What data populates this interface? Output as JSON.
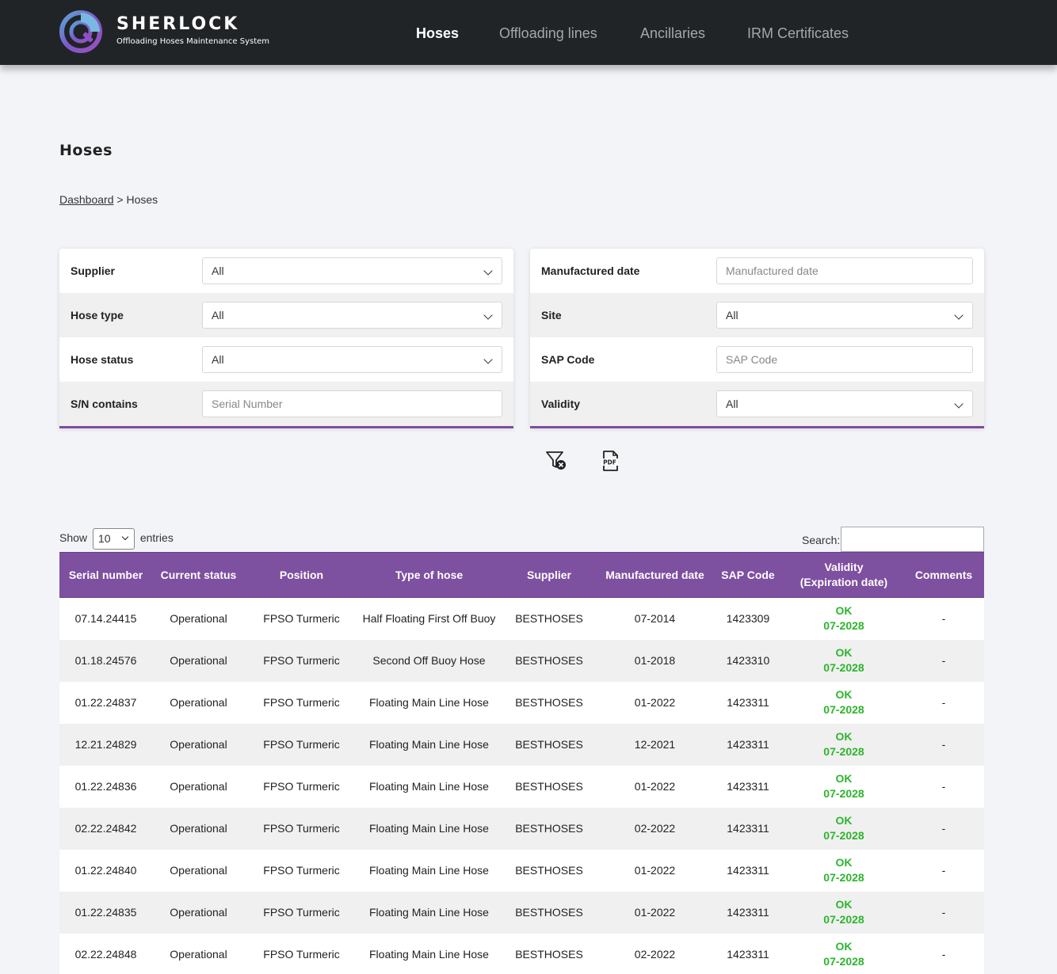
{
  "brand": {
    "name": "SHERLOCK",
    "subtitle": "Offloading Hoses Maintenance System"
  },
  "nav": [
    {
      "label": "Hoses",
      "active": true
    },
    {
      "label": "Offloading lines",
      "active": false
    },
    {
      "label": "Ancillaries",
      "active": false
    },
    {
      "label": "IRM Certificates",
      "active": false
    }
  ],
  "page": {
    "title": "Hoses"
  },
  "breadcrumb": {
    "root": "Dashboard",
    "separator": ">",
    "current": "Hoses"
  },
  "filters": {
    "supplier": {
      "label": "Supplier",
      "value": "All"
    },
    "hose_type": {
      "label": "Hose type",
      "value": "All"
    },
    "hose_status": {
      "label": "Hose status",
      "value": "All"
    },
    "sn": {
      "label": "S/N contains",
      "placeholder": "Serial Number"
    },
    "manufactured_date": {
      "label": "Manufactured date",
      "placeholder": "Manufactured date"
    },
    "site": {
      "label": "Site",
      "value": "All"
    },
    "sap_code": {
      "label": "SAP Code",
      "placeholder": "SAP Code"
    },
    "validity": {
      "label": "Validity",
      "value": "All"
    }
  },
  "actions": {
    "clear_filter_icon": "filter-clear-icon",
    "pdf_icon": "pdf-export-icon"
  },
  "table_controls": {
    "show_label": "Show",
    "entries_value": "10",
    "entries_label": "entries",
    "search_label": "Search:"
  },
  "table": {
    "headers": [
      "Serial number",
      "Current status",
      "Position",
      "Type of hose",
      "Supplier",
      "Manufactured date",
      "SAP Code",
      "Validity\n(Expiration date)",
      "Comments"
    ],
    "rows": [
      [
        "07.14.24415",
        "Operational",
        "FPSO Turmeric",
        "Half Floating First Off Buoy",
        "BESTHOSES",
        "07-2014",
        "1423309",
        "OK",
        "07-2028",
        "-"
      ],
      [
        "01.18.24576",
        "Operational",
        "FPSO Turmeric",
        "Second Off Buoy Hose",
        "BESTHOSES",
        "01-2018",
        "1423310",
        "OK",
        "07-2028",
        "-"
      ],
      [
        "01.22.24837",
        "Operational",
        "FPSO Turmeric",
        "Floating Main Line Hose",
        "BESTHOSES",
        "01-2022",
        "1423311",
        "OK",
        "07-2028",
        "-"
      ],
      [
        "12.21.24829",
        "Operational",
        "FPSO Turmeric",
        "Floating Main Line Hose",
        "BESTHOSES",
        "12-2021",
        "1423311",
        "OK",
        "07-2028",
        "-"
      ],
      [
        "01.22.24836",
        "Operational",
        "FPSO Turmeric",
        "Floating Main Line Hose",
        "BESTHOSES",
        "01-2022",
        "1423311",
        "OK",
        "07-2028",
        "-"
      ],
      [
        "02.22.24842",
        "Operational",
        "FPSO Turmeric",
        "Floating Main Line Hose",
        "BESTHOSES",
        "02-2022",
        "1423311",
        "OK",
        "07-2028",
        "-"
      ],
      [
        "01.22.24840",
        "Operational",
        "FPSO Turmeric",
        "Floating Main Line Hose",
        "BESTHOSES",
        "01-2022",
        "1423311",
        "OK",
        "07-2028",
        "-"
      ],
      [
        "01.22.24835",
        "Operational",
        "FPSO Turmeric",
        "Floating Main Line Hose",
        "BESTHOSES",
        "01-2022",
        "1423311",
        "OK",
        "07-2028",
        "-"
      ],
      [
        "02.22.24848",
        "Operational",
        "FPSO Turmeric",
        "Floating Main Line Hose",
        "BESTHOSES",
        "02-2022",
        "1423311",
        "OK",
        "07-2028",
        "-"
      ]
    ]
  },
  "colors": {
    "header_bg": "#212427",
    "accent": "#7e50a0",
    "valid_ok": "#2db52d"
  }
}
